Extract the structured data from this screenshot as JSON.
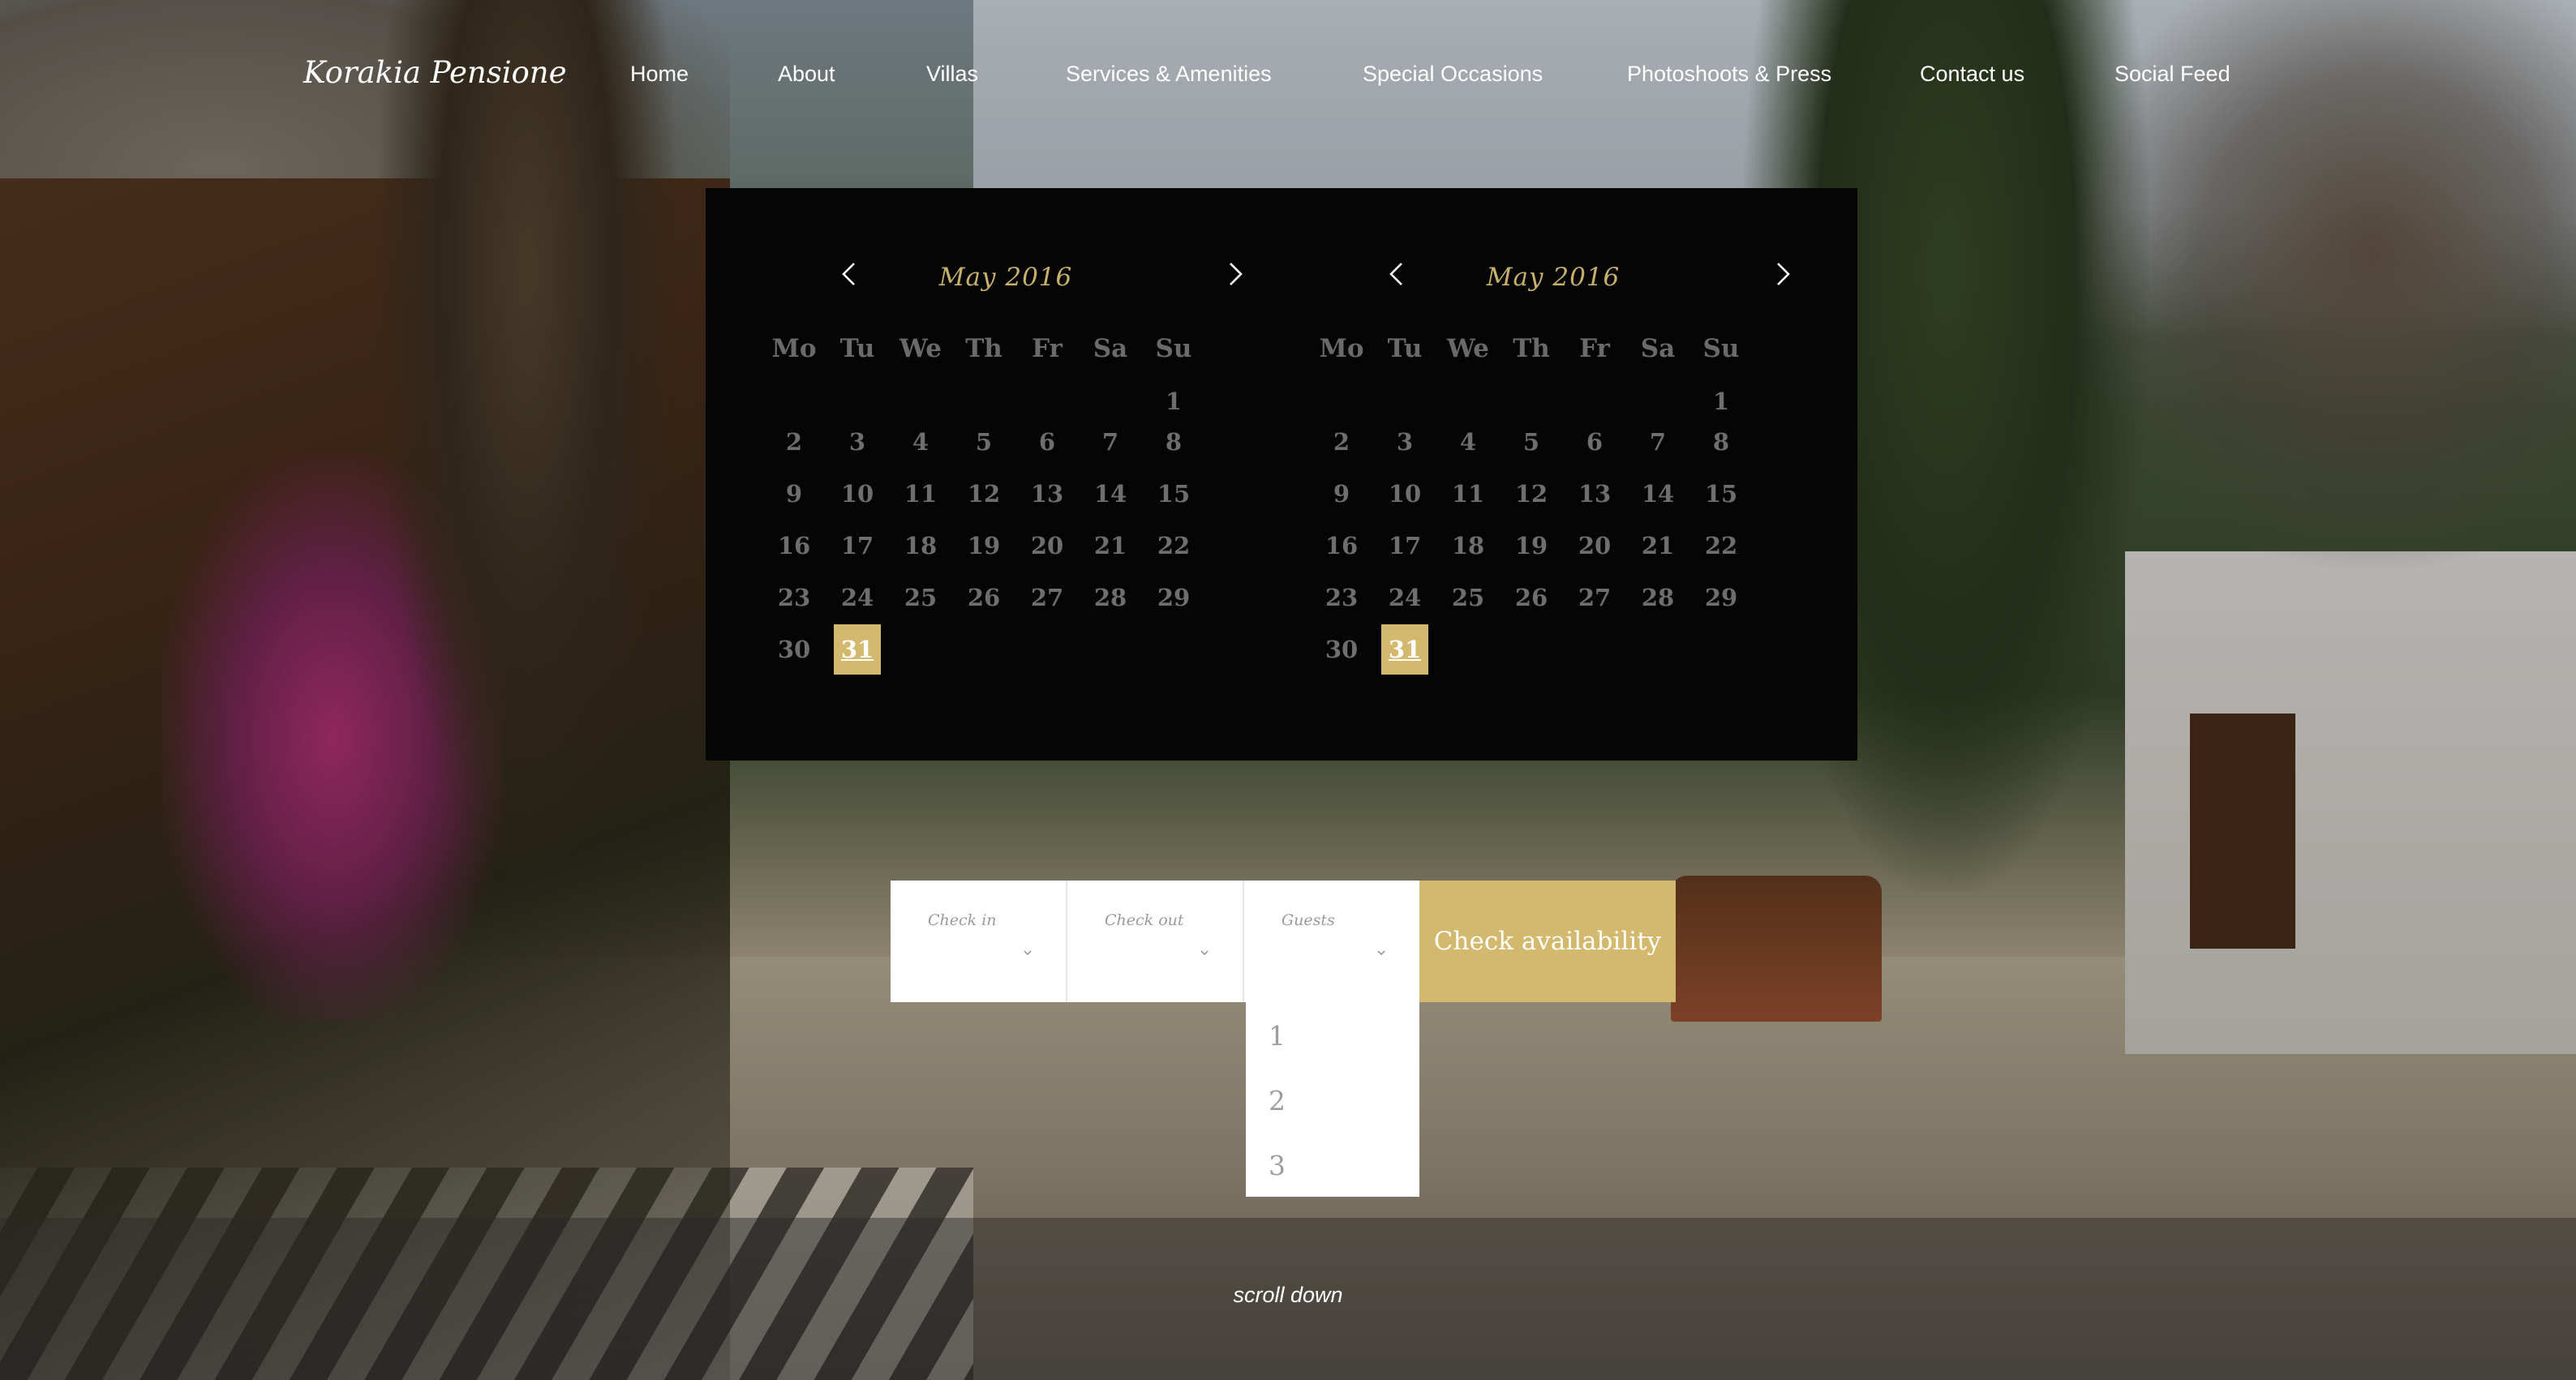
{
  "brand": {
    "logo_text": "Korakia Pensione"
  },
  "nav": {
    "items": [
      {
        "label": "Home"
      },
      {
        "label": "About"
      },
      {
        "label": "Villas"
      },
      {
        "label": "Services & Amenities"
      },
      {
        "label": "Special Occasions"
      },
      {
        "label": "Photoshoots & Press"
      },
      {
        "label": "Contact us"
      },
      {
        "label": "Social Feed"
      }
    ]
  },
  "calendar": {
    "weekdays": [
      "Mo",
      "Tu",
      "We",
      "Th",
      "Fr",
      "Sa",
      "Su"
    ],
    "months": [
      {
        "title": "May 2016",
        "prev_icon": "chevron-left-icon",
        "next_icon": "chevron-right-icon",
        "weeks": [
          [
            "",
            "",
            "",
            "",
            "",
            "",
            "1"
          ],
          [
            "2",
            "3",
            "4",
            "5",
            "6",
            "7",
            "8"
          ],
          [
            "9",
            "10",
            "11",
            "12",
            "13",
            "14",
            "15"
          ],
          [
            "16",
            "17",
            "18",
            "19",
            "20",
            "21",
            "22"
          ],
          [
            "23",
            "24",
            "25",
            "26",
            "27",
            "28",
            "29"
          ],
          [
            "30",
            "31",
            "",
            "",
            "",
            "",
            ""
          ]
        ],
        "selected_day": "31"
      },
      {
        "title": "May 2016",
        "prev_icon": "chevron-left-icon",
        "next_icon": "chevron-right-icon",
        "weeks": [
          [
            "",
            "",
            "",
            "",
            "",
            "",
            "1"
          ],
          [
            "2",
            "3",
            "4",
            "5",
            "6",
            "7",
            "8"
          ],
          [
            "9",
            "10",
            "11",
            "12",
            "13",
            "14",
            "15"
          ],
          [
            "16",
            "17",
            "18",
            "19",
            "20",
            "21",
            "22"
          ],
          [
            "23",
            "24",
            "25",
            "26",
            "27",
            "28",
            "29"
          ],
          [
            "30",
            "31",
            "",
            "",
            "",
            "",
            ""
          ]
        ],
        "selected_day": "31"
      }
    ],
    "accent_color": "#d3b96d"
  },
  "booking": {
    "check_in_label": "Check in",
    "check_out_label": "Check out",
    "guests_label": "Guests",
    "submit_label": "Check availability",
    "guest_options": [
      "1",
      "2",
      "3"
    ]
  },
  "footer": {
    "scroll_label": "scroll down"
  }
}
